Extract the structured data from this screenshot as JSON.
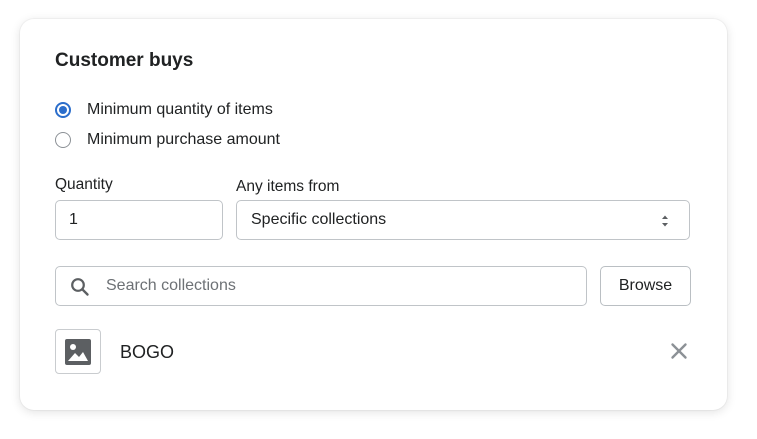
{
  "section": {
    "title": "Customer buys"
  },
  "options": [
    {
      "label": "Minimum quantity of items",
      "checked": true
    },
    {
      "label": "Minimum purchase amount",
      "checked": false
    }
  ],
  "quantity": {
    "label": "Quantity",
    "value": "1"
  },
  "items_from": {
    "label": "Any items from",
    "selected": "Specific collections"
  },
  "search": {
    "placeholder": "Search collections",
    "browse_label": "Browse"
  },
  "selected_items": [
    {
      "name": "BOGO",
      "icon": "image-placeholder-icon"
    }
  ],
  "colors": {
    "accent": "#2c6ecb",
    "text": "#202223",
    "muted": "#6d7175"
  }
}
